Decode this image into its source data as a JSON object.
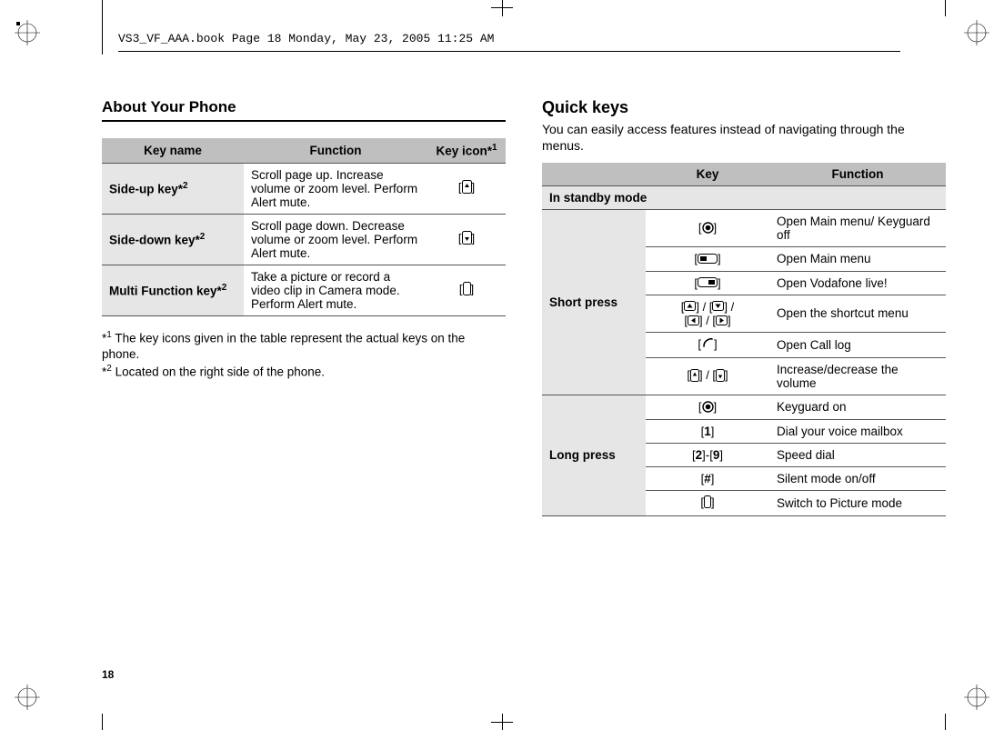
{
  "header_line": "VS3_VF_AAA.book  Page 18  Monday, May 23, 2005  11:25 AM",
  "page_number": "18",
  "section_title": "About Your Phone",
  "table1": {
    "h1": "Key name",
    "h2": "Function",
    "h3": "Key icon*",
    "h3_sup": "1",
    "r1c1": "Side-up key*",
    "r1c1_sup": "2",
    "r1c2": "Scroll page up. Increase volume or zoom level. Perform Alert mute.",
    "r2c1": "Side-down key*",
    "r2c1_sup": "2",
    "r2c2": "Scroll page down. Decrease volume or zoom level. Perform Alert mute.",
    "r3c1": "Multi Function key*",
    "r3c1_sup": "2",
    "r3c2": "Take a picture or record a video clip in Camera mode. Perform Alert mute."
  },
  "footnote1_pre": "*",
  "footnote1_sup": "1",
  "footnote1_text": " The key icons given in the table represent the actual keys on the phone.",
  "footnote2_pre": "*",
  "footnote2_sup": "2",
  "footnote2_text": " Located on the right side of the phone.",
  "quickkeys": {
    "title": "Quick keys",
    "desc": "You can easily access features instead of navigating through the menus.",
    "h1": "Key",
    "h2": "Function",
    "mode_header": "In standby mode",
    "short_label": "Short press",
    "long_label": "Long press",
    "sp1_fn": "Open Main menu/ Keyguard off",
    "sp2_fn": "Open Main menu",
    "sp3_fn": "Open Vodafone live!",
    "sp4_fn": "Open the shortcut menu",
    "sp5_fn": "Open Call log",
    "sp6_fn": "Increase/decrease the volume",
    "lp1_fn": "Keyguard on",
    "lp2_fn": "Dial your voice mailbox",
    "lp3_key_b": "2",
    "lp3_key_sep": "-",
    "lp3_key_e": "9",
    "lp3_fn": "Speed dial",
    "lp4_fn": "Silent mode on/off",
    "lp5_fn": "Switch to Picture mode",
    "key_1": "1",
    "key_hash": "#"
  }
}
